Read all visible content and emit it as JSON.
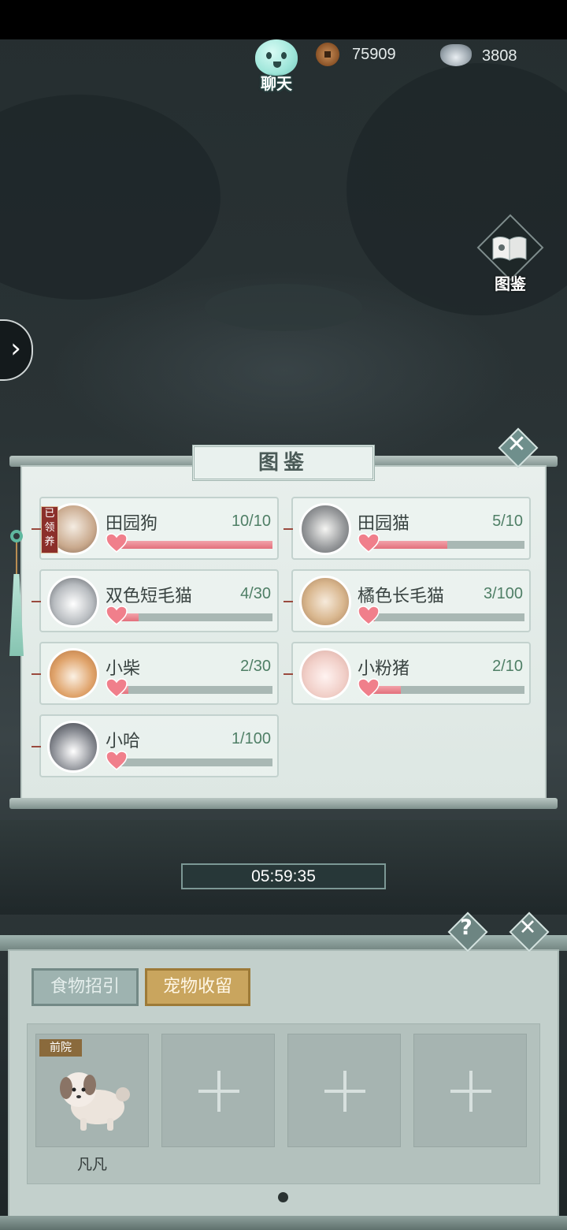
{
  "hud": {
    "chat_label": "聊天",
    "coins": "75909",
    "silver": "3808",
    "atlas_label": "图鉴"
  },
  "collection": {
    "title": "图鉴",
    "adopted_badge": "已领养",
    "pets": [
      {
        "name": "田园狗",
        "count": "10/10",
        "progress": 1.0
      },
      {
        "name": "田园猫",
        "count": "5/10",
        "progress": 0.5
      },
      {
        "name": "双色短毛猫",
        "count": "4/30",
        "progress": 0.133
      },
      {
        "name": "橘色长毛猫",
        "count": "3/100",
        "progress": 0.03
      },
      {
        "name": "小柴",
        "count": "2/30",
        "progress": 0.067
      },
      {
        "name": "小粉猪",
        "count": "2/10",
        "progress": 0.2
      },
      {
        "name": "小哈",
        "count": "1/100",
        "progress": 0.01
      }
    ]
  },
  "timer": "05:59:35",
  "pet_panel": {
    "help_glyph": "?",
    "tabs": {
      "food": "食物招引",
      "pet": "宠物收留"
    },
    "slot_tag": "前院",
    "pet_name": "凡凡"
  },
  "colors": {
    "progress_fill": "#e3707c",
    "count_text": "#4f7f66",
    "active_tab": "#c9a55e"
  }
}
